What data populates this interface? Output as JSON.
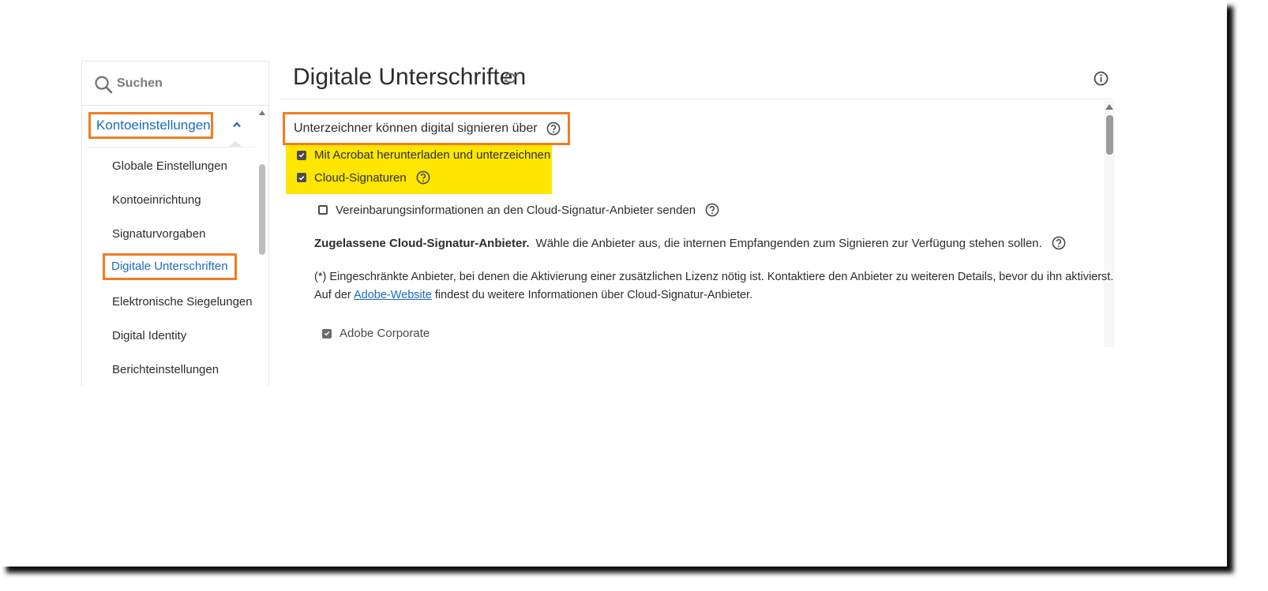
{
  "sidebar": {
    "search": {
      "placeholder": "Suchen"
    },
    "section_title": "Kontoeinstellungen",
    "items": [
      {
        "label": "Globale Einstellungen"
      },
      {
        "label": "Kontoeinrichtung"
      },
      {
        "label": "Signaturvorgaben"
      },
      {
        "label": "Digitale Unterschriften",
        "active": true
      },
      {
        "label": "Elektronische Siegelungen"
      },
      {
        "label": "Digital Identity"
      },
      {
        "label": "Berichteinstellungen"
      }
    ]
  },
  "main": {
    "title": "Digitale Unterschriften",
    "signing_heading": "Unterzeichner können digital signieren über",
    "options": [
      {
        "label": "Mit Acrobat herunterladen und unterzeichnen",
        "checked": true
      },
      {
        "label": "Cloud-Signaturen",
        "checked": true
      }
    ],
    "send_info_label": "Vereinbarungsinformationen an den Cloud-Signatur-Anbieter senden",
    "send_info_checked": false,
    "providers_bold": "Zugelassene Cloud-Signatur-Anbieter.",
    "providers_desc": "Wähle die Anbieter aus, die internen Empfangenden zum Signieren zur Verfügung stehen sollen.",
    "note_line1": "(*) Eingeschränkte Anbieter, bei denen die Aktivierung einer zusätzlichen Lizenz nötig ist. Kontaktiere den Anbieter zu weiteren Details, bevor du ihn aktivierst.",
    "note_line2_prefix": "Auf der",
    "note_link": "Adobe-Website",
    "note_line2_suffix": "findest du weitere Informationen über Cloud-Signatur-Anbieter.",
    "provider_label": "Adobe Corporate",
    "provider_checked": true
  },
  "colors": {
    "highlight_border": "#f07d22",
    "highlight_fill": "#ffe600",
    "link": "#1a6cc2"
  }
}
